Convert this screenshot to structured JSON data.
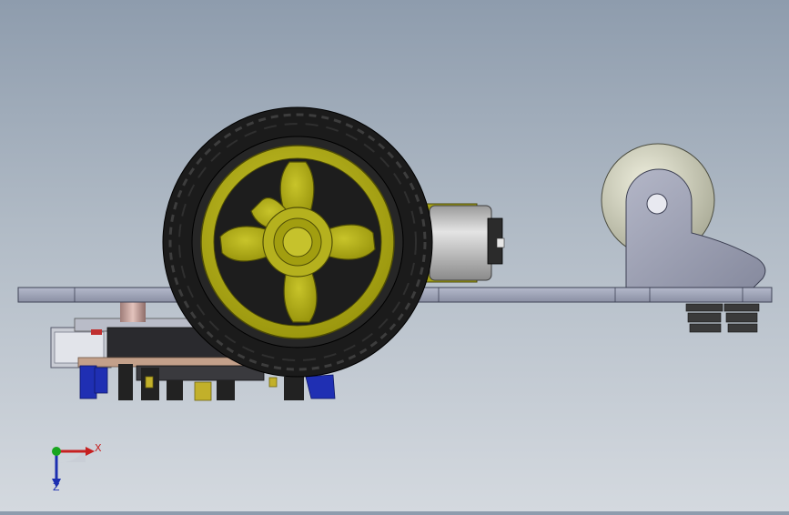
{
  "viewport": {
    "background_top": "#8e9cad",
    "background_bottom": "#d4d9df"
  },
  "model": {
    "wheel": {
      "tire_color": "#1b1b1b",
      "rim_color": "#a8a413"
    },
    "motor": {
      "color": "#b4b4b4"
    },
    "caster": {
      "ball_color": "#d7d8c6",
      "bracket_color": "#9c9fb2"
    },
    "chassis": {
      "color": "#9aa0b4"
    },
    "connectors": {
      "color": "#1f2fb3"
    }
  },
  "triad": {
    "x_label": "X",
    "z_label": "Z",
    "x_color": "#c62020",
    "z_color": "#1c2fb0",
    "origin_color": "#18a51e"
  }
}
